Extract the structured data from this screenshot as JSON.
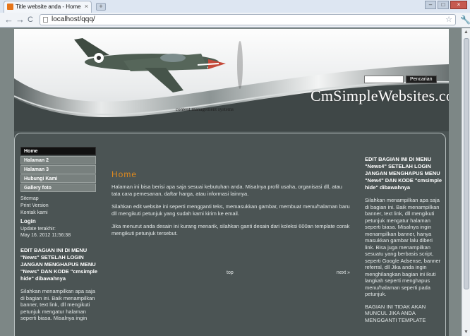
{
  "browser": {
    "tab_title": "Title website anda - Home",
    "tab_close": "×",
    "new_tab": "+",
    "url": "localhost/qqq/",
    "back": "←",
    "forward": "→",
    "reload": "C",
    "star": "☆",
    "wrench": "🔧",
    "win_min": "‒",
    "win_max": "□",
    "win_close": "×"
  },
  "header": {
    "site_title": "CmSimpleWebsites.com",
    "slogan": "content management systems",
    "search_button": "Pencarian",
    "search_value": ""
  },
  "menu": {
    "items": [
      {
        "label": "Home",
        "active": true
      },
      {
        "label": "Halaman 2",
        "active": false
      },
      {
        "label": "Halaman 3",
        "active": false
      },
      {
        "label": "Hubungi Kami",
        "active": false
      },
      {
        "label": "Gallery foto",
        "active": false
      }
    ],
    "sublinks": [
      "Sitemap",
      "Print Version",
      "Kontak kami"
    ],
    "login": "Login",
    "updated_label": "Update terakhir:",
    "updated_value": "May 16. 2012 11:56:38"
  },
  "left_news": {
    "heading": "EDIT BAGIAN INI DI MENU \"News\" SETELAH LOGIN JANGAN MENGHAPUS MENU \"News\" DAN KODE \"cmsimple hide\" dibawahnya",
    "text": "Silahkan menampilkan apa saja di bagian ini. Baik menampilkan banner, text link, dll mengikuti petunjuk mengatur halaman seperti biasa. Misalnya ingin"
  },
  "right_news": {
    "heading": "EDIT BAGIAN INI DI MENU \"News4\" SETELAH LOGIN JANGAN MENGHAPUS MENU \"New4\" DAN KODE \"cmsimple hide\" dibawahnya",
    "text": "Silahkan menampilkan apa saja di bagian ini. Baik menampilkan banner, text link, dll mengikuti petunjuk mengatur halaman seperti biasa. Misalnya ingin menampilkan banner, hanya masukkan gambar lalu diberi link. Bisa juga menampilkan sesuatu yang berbasis script, seperti Google Adsense, banner referral, dll Jika anda ingin menghilangkan bagian ini ikuti langkah seperti menghapus menu/halaman seperti pada petunjuk.",
    "text2": "BAGIAN INI TIDAK AKAN MUNCUL JIKA ANDA MENGGANTI TEMPLATE"
  },
  "main": {
    "title": "Home",
    "p1": "Halaman ini bisa berisi apa saja sesuai kebutuhan anda. Misalnya profil usaha, organisasi dll, atau tata cara pemesanan, daftar harga, atau informasi lainnya.",
    "p2": "Silahkan edit website ini seperti mengganti teks, memasukkan gambar, membuat menu/halaman baru dll mengikuti petunjuk yang sudah kami kirim ke email.",
    "p3": "Jika menurut anda desain ini kurang menarik, silahkan ganti desain dari koleksi 600an template corak mengikuti petunjuk tersebut.",
    "top_link": "top",
    "next_link": "next »"
  },
  "colors": {
    "page_bg": "#4b5454",
    "accent": "#e08a1e",
    "menu_active": "#111111"
  }
}
